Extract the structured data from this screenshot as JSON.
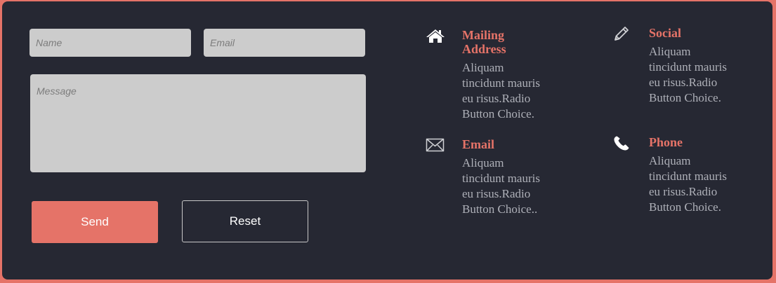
{
  "form": {
    "name_placeholder": "Name",
    "email_placeholder": "Email",
    "message_placeholder": "Message",
    "send_label": "Send",
    "reset_label": "Reset"
  },
  "contact_info": {
    "mailing_address": {
      "icon": "home-icon",
      "title": "Mailing Address",
      "text": "Aliquam tincidunt mauris eu risus.Radio Button Choice."
    },
    "social": {
      "icon": "pencil-icon",
      "title": "Social",
      "text": "Aliquam tincidunt mauris eu risus.Radio Button Choice."
    },
    "email": {
      "icon": "envelope-icon",
      "title": "Email",
      "text": "Aliquam tincidunt mauris eu risus.Radio Button Choice.."
    },
    "phone": {
      "icon": "phone-icon",
      "title": "Phone",
      "text": "Aliquam tincidunt mauris eu risus.Radio Button Choice."
    }
  },
  "colors": {
    "accent": "#e57368",
    "panel_bg": "#262833",
    "field_bg": "#cccccc",
    "body_text": "#aeb0b8"
  }
}
